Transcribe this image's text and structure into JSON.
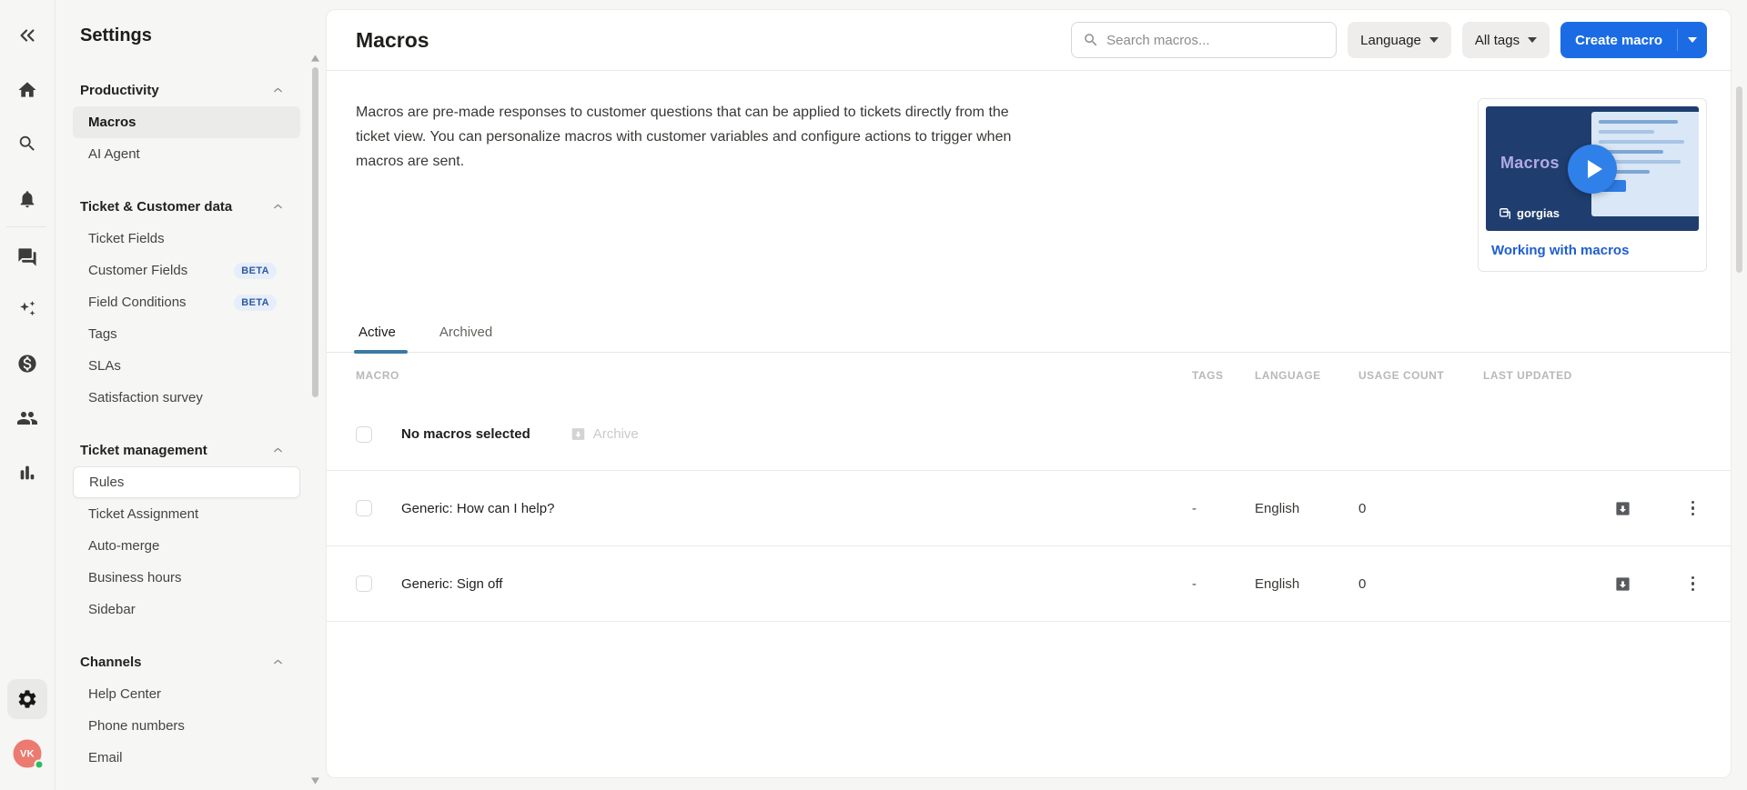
{
  "rail": {
    "icons": [
      {
        "name": "collapse-sidebar"
      },
      {
        "name": "home"
      },
      {
        "name": "search"
      },
      {
        "name": "notifications"
      },
      {
        "name": "conversations"
      },
      {
        "name": "ai-assistant"
      },
      {
        "name": "revenue"
      },
      {
        "name": "customers"
      },
      {
        "name": "statistics"
      },
      {
        "name": "settings"
      }
    ],
    "avatar": {
      "initials": "VK",
      "status": "online"
    }
  },
  "sidebar": {
    "title": "Settings",
    "sections": [
      {
        "label": "Productivity",
        "items": [
          {
            "label": "Macros"
          },
          {
            "label": "AI Agent"
          }
        ]
      },
      {
        "label": "Ticket & Customer data",
        "items": [
          {
            "label": "Ticket Fields"
          },
          {
            "label": "Customer Fields",
            "badge": "BETA"
          },
          {
            "label": "Field Conditions",
            "badge": "BETA"
          },
          {
            "label": "Tags"
          },
          {
            "label": "SLAs"
          },
          {
            "label": "Satisfaction survey"
          }
        ]
      },
      {
        "label": "Ticket management",
        "items": [
          {
            "label": "Rules"
          },
          {
            "label": "Ticket Assignment"
          },
          {
            "label": "Auto-merge"
          },
          {
            "label": "Business hours"
          },
          {
            "label": "Sidebar"
          }
        ]
      },
      {
        "label": "Channels",
        "items": [
          {
            "label": "Help Center"
          },
          {
            "label": "Phone numbers"
          },
          {
            "label": "Email"
          }
        ]
      }
    ]
  },
  "header": {
    "title": "Macros",
    "search_placeholder": "Search macros...",
    "language_button": "Language",
    "tags_button": "All tags",
    "create_button": "Create macro"
  },
  "intro": {
    "description": "Macros are pre-made responses to customer questions that can be applied to tickets directly from the ticket view. You can personalize macros with customer variables and configure actions to trigger when macros are sent."
  },
  "video": {
    "thumbnail_title": "Macros",
    "brand": "gorgias",
    "link_label": "Working with macros"
  },
  "tabs": [
    {
      "label": "Active",
      "active": true
    },
    {
      "label": "Archived",
      "active": false
    }
  ],
  "table": {
    "columns": [
      "MACRO",
      "TAGS",
      "LANGUAGE",
      "USAGE COUNT",
      "LAST UPDATED"
    ],
    "selection_text": "No macros selected",
    "archive_action": "Archive",
    "rows": [
      {
        "macro": "Generic: How can I help?",
        "tags": "-",
        "language": "English",
        "usage_count": "0",
        "last_updated": ""
      },
      {
        "macro": "Generic: Sign off",
        "tags": "-",
        "language": "English",
        "usage_count": "0",
        "last_updated": ""
      }
    ]
  },
  "colors": {
    "accent_blue": "#1b6ce4",
    "link_blue": "#1e5ed0",
    "tab_underline": "#3a7ba1",
    "badge_bg": "#e7eefb",
    "badge_text": "#2d5a9e",
    "avatar_bg": "#ec7a70",
    "online_green": "#2fbd5d",
    "page_bg": "#f6f6f5"
  }
}
